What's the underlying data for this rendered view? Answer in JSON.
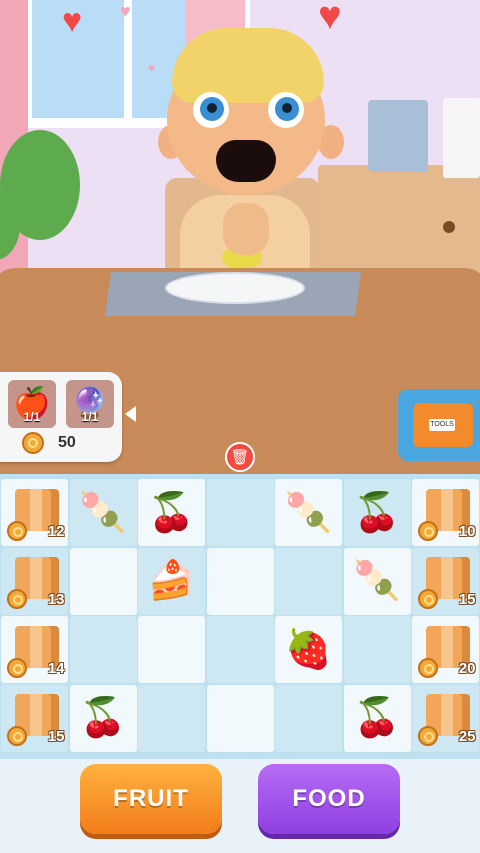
{
  "inventory": {
    "slots": [
      {
        "icon": "apple-booster-icon",
        "count": "1/1"
      },
      {
        "icon": "magic-orb-booster-icon",
        "count": "1/1"
      }
    ],
    "coins": "50"
  },
  "toolbox": {
    "label": "TOOLS"
  },
  "board": {
    "rows": [
      [
        {
          "type": "crate",
          "cost": "12"
        },
        {
          "type": "item",
          "icon": "🍡",
          "name": "popsicle-blue"
        },
        {
          "type": "item",
          "icon": "🍒",
          "name": "cherries"
        },
        {
          "type": "empty"
        },
        {
          "type": "item",
          "icon": "🍡",
          "name": "popsicle-pink"
        },
        {
          "type": "item",
          "icon": "🍒",
          "name": "cherries"
        },
        {
          "type": "crate",
          "cost": "10"
        }
      ],
      [
        {
          "type": "crate",
          "cost": "13"
        },
        {
          "type": "empty"
        },
        {
          "type": "item",
          "icon": "🍰",
          "name": "cake-slice"
        },
        {
          "type": "empty"
        },
        {
          "type": "empty"
        },
        {
          "type": "item",
          "icon": "🍡",
          "name": "popsicle-pink"
        },
        {
          "type": "crate",
          "cost": "15"
        }
      ],
      [
        {
          "type": "crate",
          "cost": "14"
        },
        {
          "type": "empty"
        },
        {
          "type": "empty"
        },
        {
          "type": "empty"
        },
        {
          "type": "item",
          "icon": "🍓",
          "name": "strawberry"
        },
        {
          "type": "empty"
        },
        {
          "type": "crate",
          "cost": "20"
        }
      ],
      [
        {
          "type": "crate",
          "cost": "15"
        },
        {
          "type": "item",
          "icon": "🍒",
          "name": "cherries"
        },
        {
          "type": "empty"
        },
        {
          "type": "empty"
        },
        {
          "type": "empty"
        },
        {
          "type": "item",
          "icon": "🍒",
          "name": "cherries"
        },
        {
          "type": "crate",
          "cost": "25"
        }
      ]
    ]
  },
  "buttons": {
    "fruit": "FRUIT",
    "food": "FOOD"
  },
  "colors": {
    "fruit": "#f69028",
    "food": "#a458ec",
    "trash": "#f24a3e"
  }
}
